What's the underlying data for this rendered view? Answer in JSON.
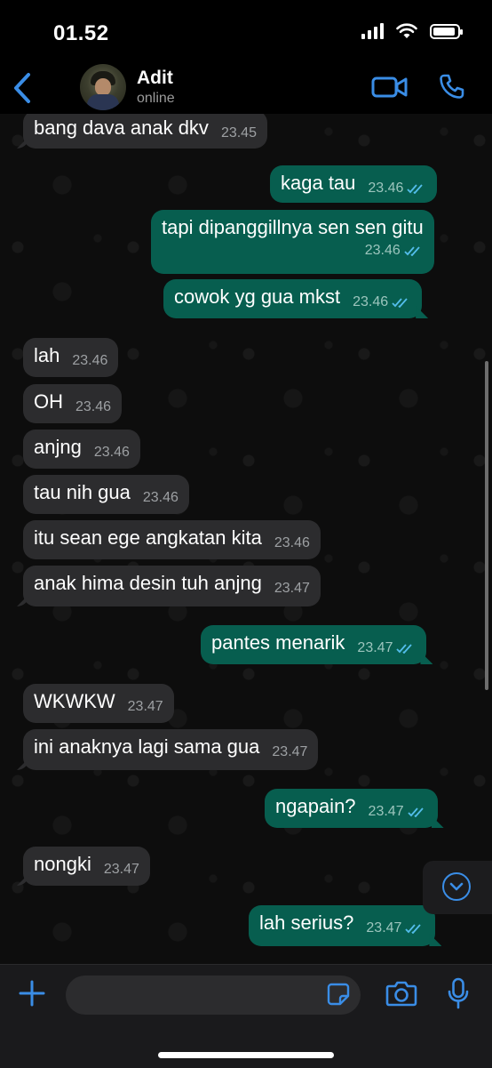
{
  "status_bar": {
    "time": "01.52"
  },
  "header": {
    "contact_name": "Adit",
    "contact_status": "online"
  },
  "colors": {
    "accent": "#3a8de6",
    "incoming_bubble": "#2c2c2e",
    "outgoing_bubble": "#075e4f",
    "read_ticks": "#53bdeb"
  },
  "messages": [
    {
      "dir": "in",
      "text": "bang dava anak dkv",
      "time": "23.45"
    },
    {
      "dir": "out",
      "text": "kaga tau",
      "time": "23.46",
      "read": true
    },
    {
      "dir": "out",
      "text": "tapi dipanggillnya sen sen gitu",
      "time": "23.46",
      "read": true
    },
    {
      "dir": "out",
      "text": "cowok yg gua mkst",
      "time": "23.46",
      "read": true
    },
    {
      "dir": "in",
      "text": "lah",
      "time": "23.46"
    },
    {
      "dir": "in",
      "text": "OH",
      "time": "23.46"
    },
    {
      "dir": "in",
      "text": "anjng",
      "time": "23.46"
    },
    {
      "dir": "in",
      "text": "tau nih gua",
      "time": "23.46"
    },
    {
      "dir": "in",
      "text": "itu sean ege angkatan kita",
      "time": "23.46"
    },
    {
      "dir": "in",
      "text": "anak hima desin tuh anjng",
      "time": "23.47"
    },
    {
      "dir": "out",
      "text": "pantes menarik",
      "time": "23.47",
      "read": true
    },
    {
      "dir": "in",
      "text": "WKWKW",
      "time": "23.47"
    },
    {
      "dir": "in",
      "text": "ini anaknya lagi sama gua",
      "time": "23.47"
    },
    {
      "dir": "out",
      "text": "ngapain?",
      "time": "23.47",
      "read": true
    },
    {
      "dir": "in",
      "text": "nongki",
      "time": "23.47"
    },
    {
      "dir": "out",
      "text": "lah serius?",
      "time": "23.47",
      "read": true
    }
  ],
  "composer": {
    "placeholder": "",
    "value": ""
  },
  "icons": {
    "back": "chevron-left-icon",
    "video": "video-call-icon",
    "call": "phone-icon",
    "scroll_down": "chevron-down-icon",
    "plus": "plus-icon",
    "sticker": "sticker-icon",
    "camera": "camera-icon",
    "mic": "microphone-icon"
  }
}
